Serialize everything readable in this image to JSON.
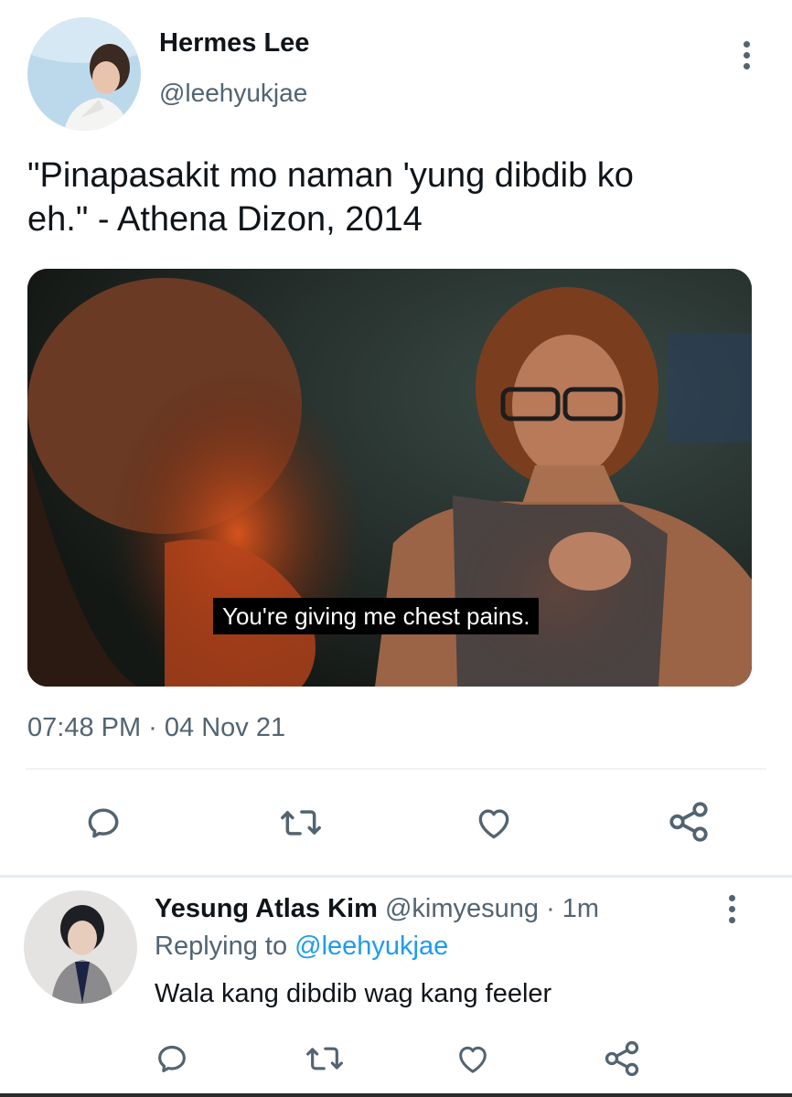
{
  "tweet": {
    "author_name": "Hermes Lee",
    "author_handle": "@leehyukjae",
    "text_line1": "\"Pinapasakit mo naman 'yung dibdib ko",
    "text_line2": "eh.\" - Athena Dizon, 2014",
    "media_subtitle": "You're giving me chest pains.",
    "timestamp": "07:48 PM · 04 Nov 21",
    "actions": [
      "reply-icon",
      "retweet-icon",
      "like-icon",
      "share-icon"
    ]
  },
  "reply": {
    "author_name": "Yesung Atlas Kim",
    "author_handle": "@kimyesung",
    "time": "· 1m",
    "replying_prefix": "Replying to",
    "replying_handle": "@leehyukjae",
    "text": "Wala kang dibdib wag kang feeler",
    "actions": [
      "reply-icon",
      "retweet-icon",
      "like-icon",
      "share-icon"
    ]
  },
  "colors": {
    "text": "#0f1419",
    "muted": "#536471",
    "link": "#1d9bf0",
    "icon": "#536471"
  }
}
